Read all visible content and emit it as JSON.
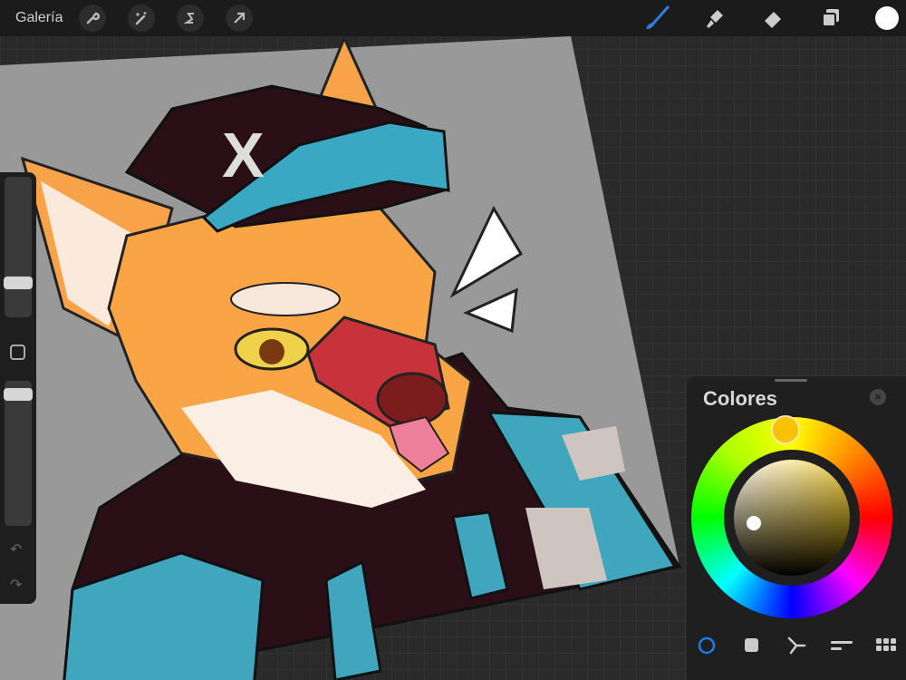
{
  "topbar": {
    "gallery_label": "Galería",
    "left_tools": [
      "wrench-icon",
      "magic-wand-icon",
      "selection-icon",
      "move-arrow-icon"
    ],
    "right_tools": [
      "brush-icon",
      "smudge-icon",
      "eraser-icon",
      "layers-icon"
    ],
    "current_color": "#ffffff",
    "brush_color": "#2f7fe0"
  },
  "sidebar": {
    "brush_size_value": 0.23,
    "opacity_value": 0.08
  },
  "colors_panel": {
    "title": "Colores",
    "selected_color": "#f8c200",
    "modes": [
      "disc",
      "classic",
      "harmony",
      "value",
      "palettes"
    ],
    "active_mode": "disc",
    "active_color": "#1a7bf0"
  }
}
